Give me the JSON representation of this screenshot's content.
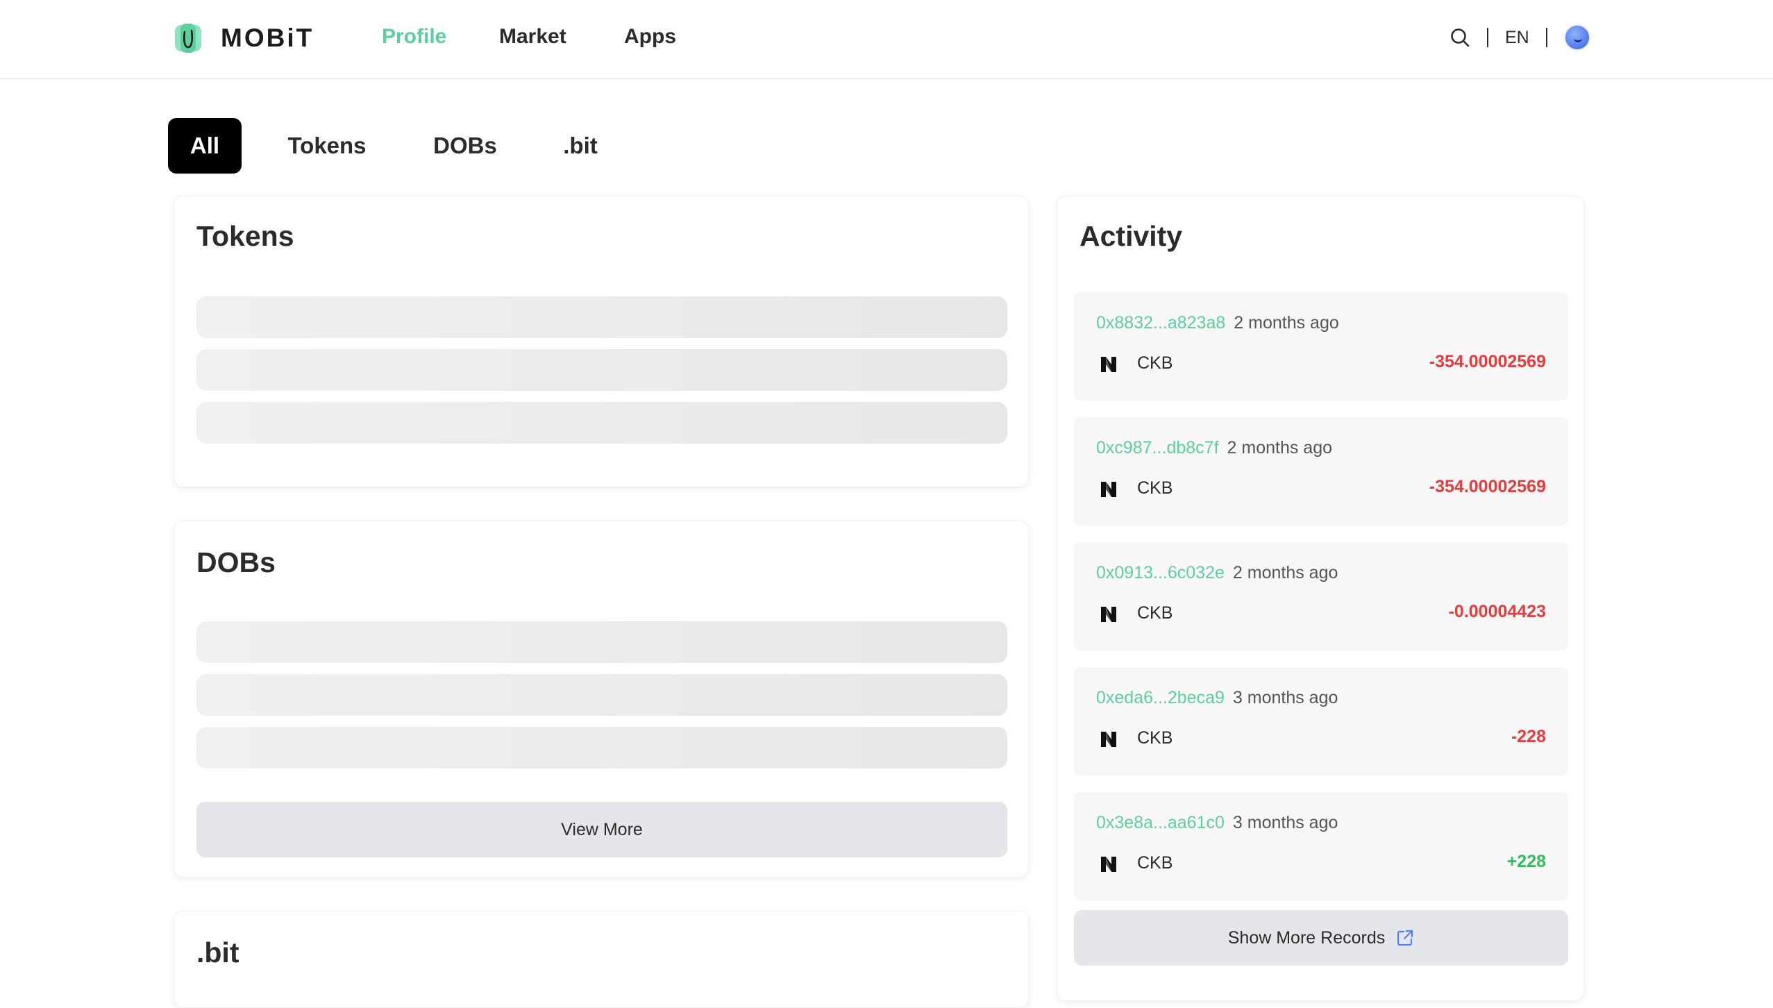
{
  "header": {
    "logo_text": "MOBiT",
    "nav": [
      {
        "label": "Profile",
        "active": true
      },
      {
        "label": "Market",
        "active": false
      },
      {
        "label": "Apps",
        "active": false
      }
    ],
    "language": "EN",
    "accent_color": "#5ccf9d"
  },
  "filter_tabs": [
    {
      "label": "All",
      "active": true
    },
    {
      "label": "Tokens",
      "active": false
    },
    {
      "label": "DOBs",
      "active": false
    },
    {
      "label": ".bit",
      "active": false
    }
  ],
  "tokens_section": {
    "title": "Tokens"
  },
  "dobs_section": {
    "title": "DOBs",
    "view_more_label": "View More"
  },
  "bit_section": {
    "title": ".bit"
  },
  "activity": {
    "title": "Activity",
    "items": [
      {
        "hash": "0x8832...a823a8",
        "time": "2 months ago",
        "token": "CKB",
        "amount": "-354.00002569",
        "direction": "out"
      },
      {
        "hash": "0xc987...db8c7f",
        "time": "2 months ago",
        "token": "CKB",
        "amount": "-354.00002569",
        "direction": "out"
      },
      {
        "hash": "0x0913...6c032e",
        "time": "2 months ago",
        "token": "CKB",
        "amount": "-0.00004423",
        "direction": "out"
      },
      {
        "hash": "0xeda6...2beca9",
        "time": "3 months ago",
        "token": "CKB",
        "amount": "-228",
        "direction": "out"
      },
      {
        "hash": "0x3e8a...aa61c0",
        "time": "3 months ago",
        "token": "CKB",
        "amount": "+228",
        "direction": "in"
      }
    ],
    "show_more_label": "Show More Records",
    "negative_color": "#ea3a3a",
    "positive_color": "#2fbf58"
  }
}
